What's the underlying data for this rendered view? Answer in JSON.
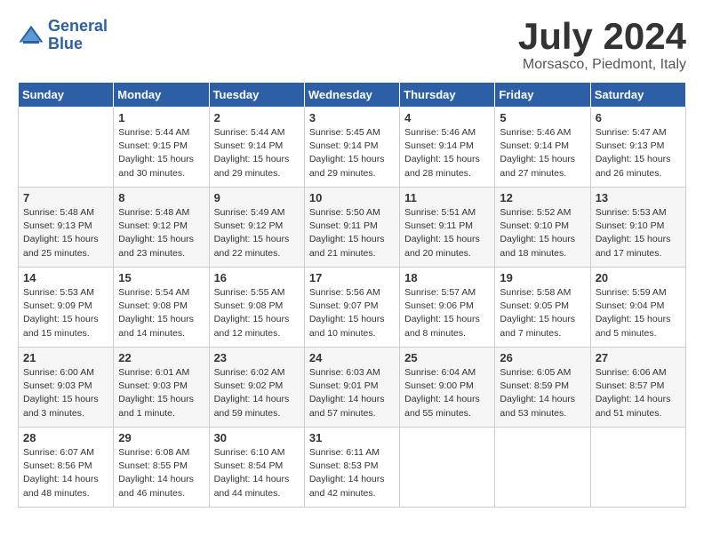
{
  "header": {
    "logo_line1": "General",
    "logo_line2": "Blue",
    "month_title": "July 2024",
    "location": "Morsasco, Piedmont, Italy"
  },
  "days_of_week": [
    "Sunday",
    "Monday",
    "Tuesday",
    "Wednesday",
    "Thursday",
    "Friday",
    "Saturday"
  ],
  "weeks": [
    [
      {
        "day": "",
        "info": ""
      },
      {
        "day": "1",
        "info": "Sunrise: 5:44 AM\nSunset: 9:15 PM\nDaylight: 15 hours\nand 30 minutes."
      },
      {
        "day": "2",
        "info": "Sunrise: 5:44 AM\nSunset: 9:14 PM\nDaylight: 15 hours\nand 29 minutes."
      },
      {
        "day": "3",
        "info": "Sunrise: 5:45 AM\nSunset: 9:14 PM\nDaylight: 15 hours\nand 29 minutes."
      },
      {
        "day": "4",
        "info": "Sunrise: 5:46 AM\nSunset: 9:14 PM\nDaylight: 15 hours\nand 28 minutes."
      },
      {
        "day": "5",
        "info": "Sunrise: 5:46 AM\nSunset: 9:14 PM\nDaylight: 15 hours\nand 27 minutes."
      },
      {
        "day": "6",
        "info": "Sunrise: 5:47 AM\nSunset: 9:13 PM\nDaylight: 15 hours\nand 26 minutes."
      }
    ],
    [
      {
        "day": "7",
        "info": "Sunrise: 5:48 AM\nSunset: 9:13 PM\nDaylight: 15 hours\nand 25 minutes."
      },
      {
        "day": "8",
        "info": "Sunrise: 5:48 AM\nSunset: 9:12 PM\nDaylight: 15 hours\nand 23 minutes."
      },
      {
        "day": "9",
        "info": "Sunrise: 5:49 AM\nSunset: 9:12 PM\nDaylight: 15 hours\nand 22 minutes."
      },
      {
        "day": "10",
        "info": "Sunrise: 5:50 AM\nSunset: 9:11 PM\nDaylight: 15 hours\nand 21 minutes."
      },
      {
        "day": "11",
        "info": "Sunrise: 5:51 AM\nSunset: 9:11 PM\nDaylight: 15 hours\nand 20 minutes."
      },
      {
        "day": "12",
        "info": "Sunrise: 5:52 AM\nSunset: 9:10 PM\nDaylight: 15 hours\nand 18 minutes."
      },
      {
        "day": "13",
        "info": "Sunrise: 5:53 AM\nSunset: 9:10 PM\nDaylight: 15 hours\nand 17 minutes."
      }
    ],
    [
      {
        "day": "14",
        "info": "Sunrise: 5:53 AM\nSunset: 9:09 PM\nDaylight: 15 hours\nand 15 minutes."
      },
      {
        "day": "15",
        "info": "Sunrise: 5:54 AM\nSunset: 9:08 PM\nDaylight: 15 hours\nand 14 minutes."
      },
      {
        "day": "16",
        "info": "Sunrise: 5:55 AM\nSunset: 9:08 PM\nDaylight: 15 hours\nand 12 minutes."
      },
      {
        "day": "17",
        "info": "Sunrise: 5:56 AM\nSunset: 9:07 PM\nDaylight: 15 hours\nand 10 minutes."
      },
      {
        "day": "18",
        "info": "Sunrise: 5:57 AM\nSunset: 9:06 PM\nDaylight: 15 hours\nand 8 minutes."
      },
      {
        "day": "19",
        "info": "Sunrise: 5:58 AM\nSunset: 9:05 PM\nDaylight: 15 hours\nand 7 minutes."
      },
      {
        "day": "20",
        "info": "Sunrise: 5:59 AM\nSunset: 9:04 PM\nDaylight: 15 hours\nand 5 minutes."
      }
    ],
    [
      {
        "day": "21",
        "info": "Sunrise: 6:00 AM\nSunset: 9:03 PM\nDaylight: 15 hours\nand 3 minutes."
      },
      {
        "day": "22",
        "info": "Sunrise: 6:01 AM\nSunset: 9:03 PM\nDaylight: 15 hours\nand 1 minute."
      },
      {
        "day": "23",
        "info": "Sunrise: 6:02 AM\nSunset: 9:02 PM\nDaylight: 14 hours\nand 59 minutes."
      },
      {
        "day": "24",
        "info": "Sunrise: 6:03 AM\nSunset: 9:01 PM\nDaylight: 14 hours\nand 57 minutes."
      },
      {
        "day": "25",
        "info": "Sunrise: 6:04 AM\nSunset: 9:00 PM\nDaylight: 14 hours\nand 55 minutes."
      },
      {
        "day": "26",
        "info": "Sunrise: 6:05 AM\nSunset: 8:59 PM\nDaylight: 14 hours\nand 53 minutes."
      },
      {
        "day": "27",
        "info": "Sunrise: 6:06 AM\nSunset: 8:57 PM\nDaylight: 14 hours\nand 51 minutes."
      }
    ],
    [
      {
        "day": "28",
        "info": "Sunrise: 6:07 AM\nSunset: 8:56 PM\nDaylight: 14 hours\nand 48 minutes."
      },
      {
        "day": "29",
        "info": "Sunrise: 6:08 AM\nSunset: 8:55 PM\nDaylight: 14 hours\nand 46 minutes."
      },
      {
        "day": "30",
        "info": "Sunrise: 6:10 AM\nSunset: 8:54 PM\nDaylight: 14 hours\nand 44 minutes."
      },
      {
        "day": "31",
        "info": "Sunrise: 6:11 AM\nSunset: 8:53 PM\nDaylight: 14 hours\nand 42 minutes."
      },
      {
        "day": "",
        "info": ""
      },
      {
        "day": "",
        "info": ""
      },
      {
        "day": "",
        "info": ""
      }
    ]
  ]
}
